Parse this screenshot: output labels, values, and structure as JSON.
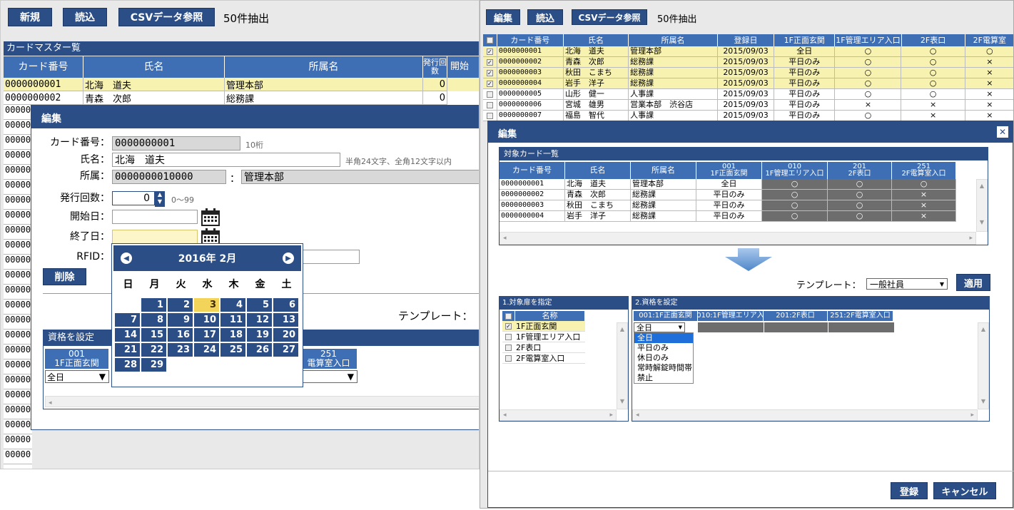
{
  "left": {
    "toolbar": {
      "new_label": "新規",
      "load_label": "読込",
      "csv_label": "CSVデータ参照",
      "count_label": "50件抽出"
    },
    "list_title": "カードマスター覧",
    "columns": [
      "カード番号",
      "氏名",
      "所属名",
      "発行回数",
      "開始"
    ],
    "rows": [
      {
        "card": "0000000001",
        "name": "北海　道夫",
        "dept": "管理本部",
        "count": "0"
      },
      {
        "card": "0000000002",
        "name": "青森　次郎",
        "dept": "総務課",
        "count": "0"
      }
    ],
    "left_stub_rows": [
      "00000",
      "00000",
      "00000",
      "00000",
      "00000",
      "00000",
      "00000",
      "00000",
      "00000",
      "00000",
      "00000",
      "00000",
      "00000",
      "00000",
      "00000",
      "00000",
      "00000",
      "00000",
      "00000",
      "00000",
      "00000",
      "00000",
      "00000",
      "00000"
    ],
    "edit": {
      "title": "編集",
      "card_label": "カード番号：",
      "card_value": "0000000001",
      "card_hint": "10桁",
      "name_label": "氏名：",
      "name_value": "北海　道夫",
      "name_hint": "半角24文字、全角12文字以内",
      "dept_label": "所属：",
      "dept_code": "0000000010000",
      "dept_sep": "：",
      "dept_name": "管理本部",
      "issue_label": "発行回数：",
      "issue_value": "0",
      "issue_hint": "0～99",
      "start_label": "開始日：",
      "end_label": "終了日：",
      "rfid_label": "RFID：",
      "delete_label": "削除",
      "template_label": "テンプレート：",
      "qual_title": "資格を設定",
      "qual_col1": "001\n1F正面玄関",
      "qual_col4": "251\n電算室入口",
      "qual_select1": "全日"
    },
    "calendar": {
      "title": "2016年 2月",
      "weekdays": [
        "日",
        "月",
        "火",
        "水",
        "木",
        "金",
        "土"
      ],
      "weeks": [
        [
          "",
          "1",
          "2",
          "3",
          "4",
          "5",
          "6"
        ],
        [
          "7",
          "8",
          "9",
          "10",
          "11",
          "12",
          "13"
        ],
        [
          "14",
          "15",
          "16",
          "17",
          "18",
          "19",
          "20"
        ],
        [
          "21",
          "22",
          "23",
          "24",
          "25",
          "26",
          "27"
        ],
        [
          "28",
          "29",
          "",
          "",
          "",
          "",
          ""
        ]
      ],
      "today": "3"
    }
  },
  "right": {
    "toolbar": {
      "edit_label": "編集",
      "load_label": "読込",
      "csv_label": "CSVデータ参照",
      "count_label": "50件抽出"
    },
    "columns": [
      "カード番号",
      "氏名",
      "所属名",
      "登録日",
      "1F正面玄関",
      "1F管理エリア入口",
      "2F表口",
      "2F電算室"
    ],
    "rows": [
      {
        "checked": true,
        "card": "0000000001",
        "name": "北海　道夫",
        "dept": "管理本部",
        "date": "2015/09/03",
        "a": "全日",
        "b": "○",
        "c": "○",
        "d": "○"
      },
      {
        "checked": true,
        "card": "0000000002",
        "name": "青森　次郎",
        "dept": "総務課",
        "date": "2015/09/03",
        "a": "平日のみ",
        "b": "○",
        "c": "○",
        "d": "×"
      },
      {
        "checked": true,
        "card": "0000000003",
        "name": "秋田　こまち",
        "dept": "総務課",
        "date": "2015/09/03",
        "a": "平日のみ",
        "b": "○",
        "c": "○",
        "d": "×"
      },
      {
        "checked": true,
        "card": "0000000004",
        "name": "岩手　洋子",
        "dept": "総務課",
        "date": "2015/09/03",
        "a": "平日のみ",
        "b": "○",
        "c": "○",
        "d": "×"
      },
      {
        "checked": false,
        "card": "0000000005",
        "name": "山形　健一",
        "dept": "人事課",
        "date": "2015/09/03",
        "a": "平日のみ",
        "b": "○",
        "c": "○",
        "d": "×"
      },
      {
        "checked": false,
        "card": "0000000006",
        "name": "宮城　雄男",
        "dept": "営業本部　渋谷店",
        "date": "2015/09/03",
        "a": "平日のみ",
        "b": "×",
        "c": "×",
        "d": "×"
      },
      {
        "checked": false,
        "card": "0000000007",
        "name": "福島　智代",
        "dept": "人事課",
        "date": "2015/09/03",
        "a": "平日のみ",
        "b": "○",
        "c": "×",
        "d": "×"
      }
    ],
    "edit": {
      "title": "編集",
      "target_title": "対象カード一覧",
      "target_columns": [
        "カード番号",
        "氏名",
        "所属名",
        "001\n1F正面玄関",
        "010\n1F管理エリア入口",
        "201\n2F表口",
        "251\n2F電算室入口"
      ],
      "target_rows": [
        {
          "card": "0000000001",
          "name": "北海　道夫",
          "dept": "管理本部",
          "a": "全日",
          "b": "○",
          "c": "○",
          "d": "○"
        },
        {
          "card": "0000000002",
          "name": "青森　次郎",
          "dept": "総務課",
          "a": "平日のみ",
          "b": "○",
          "c": "○",
          "d": "×"
        },
        {
          "card": "0000000003",
          "name": "秋田　こまち",
          "dept": "総務課",
          "a": "平日のみ",
          "b": "○",
          "c": "○",
          "d": "×"
        },
        {
          "card": "0000000004",
          "name": "岩手　洋子",
          "dept": "総務課",
          "a": "平日のみ",
          "b": "○",
          "c": "○",
          "d": "×"
        }
      ],
      "template_label": "テンプレート：",
      "template_value": "一般社員",
      "apply_label": "適用",
      "target_panel_title": "1.対象扉を指定",
      "door_header": "名称",
      "doors": [
        {
          "checked": true,
          "name": "1F正面玄関"
        },
        {
          "checked": false,
          "name": "1F管理エリア入口"
        },
        {
          "checked": false,
          "name": "2F表口"
        },
        {
          "checked": false,
          "name": "2F電算室入口"
        }
      ],
      "qual_panel_title": "2.資格を設定",
      "qual_columns": [
        "001:1F正面玄関",
        "010:1F管理エリア入",
        "201:2F表口",
        "251:2F電算室入口"
      ],
      "select_value": "全日",
      "dropdown_options": [
        "全日",
        "平日のみ",
        "休日のみ",
        "常時解錠時間帯",
        "禁止"
      ],
      "register_label": "登録",
      "cancel_label": "キャンセル"
    }
  },
  "colors": {
    "accent": "#2b4e86",
    "header": "#3e6fb5",
    "selected_row": "#f7f2b0"
  }
}
